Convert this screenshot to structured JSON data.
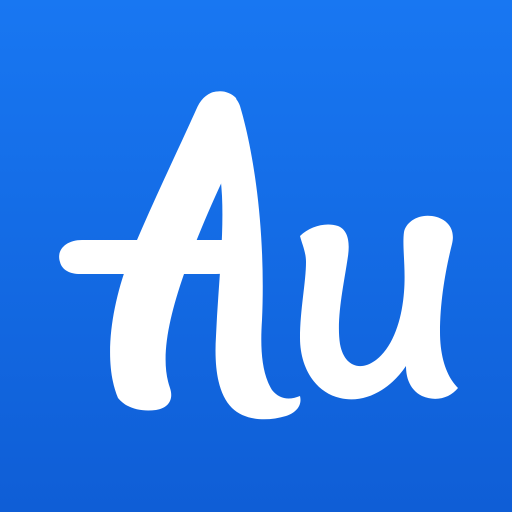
{
  "icon": {
    "name": "Au",
    "logo_text": "Au",
    "background_color": "#1877F2",
    "background_shadow_color": "#0F5ED6",
    "glyph_color": "#FFFFFF"
  }
}
